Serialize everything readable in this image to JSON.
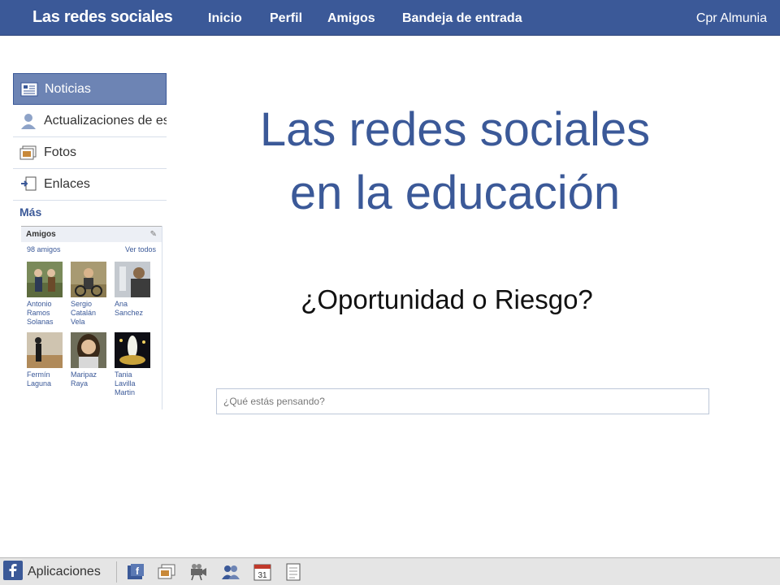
{
  "header": {
    "brand": "Las redes sociales",
    "nav": [
      "Inicio",
      "Perfil",
      "Amigos",
      "Bandeja de entrada"
    ],
    "user": "Cpr Almunia"
  },
  "sidebar": {
    "items": [
      {
        "label": "Noticias",
        "icon": "news-feed-icon"
      },
      {
        "label": "Actualizaciones de es",
        "icon": "person-icon"
      },
      {
        "label": "Fotos",
        "icon": "photos-icon"
      },
      {
        "label": "Enlaces",
        "icon": "links-icon"
      }
    ],
    "more": "Más"
  },
  "friends": {
    "title": "Amigos",
    "count": "98 amigos",
    "see_all": "Ver todos",
    "list": [
      {
        "name": "Antonio\nRamos\nSolanas"
      },
      {
        "name": "Sergio\nCatalán\nVela"
      },
      {
        "name": "Ana\nSanchez"
      },
      {
        "name": "Fermín\nLaguna"
      },
      {
        "name": "Maripaz\nRaya"
      },
      {
        "name": "Tania\nLavilla\nMartin"
      }
    ]
  },
  "main": {
    "title_line1": "Las redes sociales",
    "title_line2": "en la educación",
    "subtitle": "¿Oportunidad o Riesgo?",
    "status_placeholder": "¿Qué estás pensando?"
  },
  "bottom_bar": {
    "apps_label": "Aplicaciones",
    "icons": [
      "facebook-icon",
      "photos-icon",
      "video-camera-icon",
      "friends-icon",
      "calendar-icon",
      "notes-icon"
    ],
    "calendar_day": "31"
  },
  "colors": {
    "brand_blue": "#3b5998",
    "active_item": "#6d84b4",
    "bottom_bar": "#e5e5e5"
  }
}
